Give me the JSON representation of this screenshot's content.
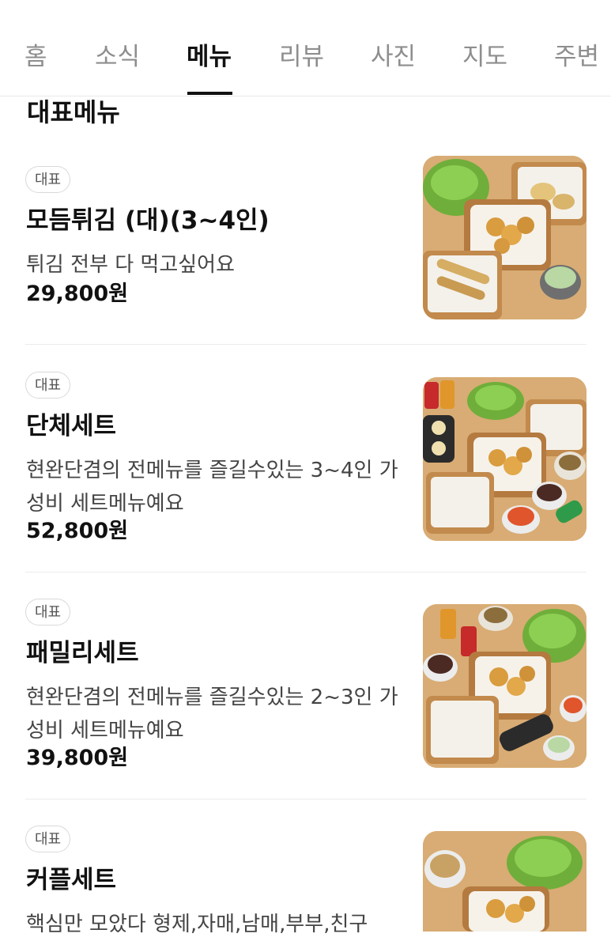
{
  "tabs": [
    {
      "label": "홈",
      "active": false
    },
    {
      "label": "소식",
      "active": false
    },
    {
      "label": "메뉴",
      "active": true
    },
    {
      "label": "리뷰",
      "active": false
    },
    {
      "label": "사진",
      "active": false
    },
    {
      "label": "지도",
      "active": false
    },
    {
      "label": "주변",
      "active": false
    }
  ],
  "section_title": "대표메뉴",
  "menu_items": [
    {
      "badge": "대표",
      "name": "모듬튀김 (대)(3~4인)",
      "description": "튀김 전부 다 먹고싶어요",
      "price": "29,800원",
      "photo_icon": "fried-food-platter"
    },
    {
      "badge": "대표",
      "name": "단체세트",
      "description": "현완단겸의 전메뉴를 즐길수있는 3~4인 가성비 세트메뉴예요",
      "price": "52,800원",
      "photo_icon": "group-set-platter"
    },
    {
      "badge": "대표",
      "name": "패밀리세트",
      "description": "현완단겸의 전메뉴를 즐길수있는 2~3인 가성비 세트메뉴예요",
      "price": "39,800원",
      "photo_icon": "family-set-platter"
    },
    {
      "badge": "대표",
      "name": "커플세트",
      "description": "핵심만 모았다 형제,자매,남매,부부,친구",
      "price": "",
      "photo_icon": "couple-set-platter"
    }
  ],
  "colors": {
    "accent": "#111111",
    "inactive_tab": "#8e8e8e",
    "wood": "#d6a86f"
  }
}
